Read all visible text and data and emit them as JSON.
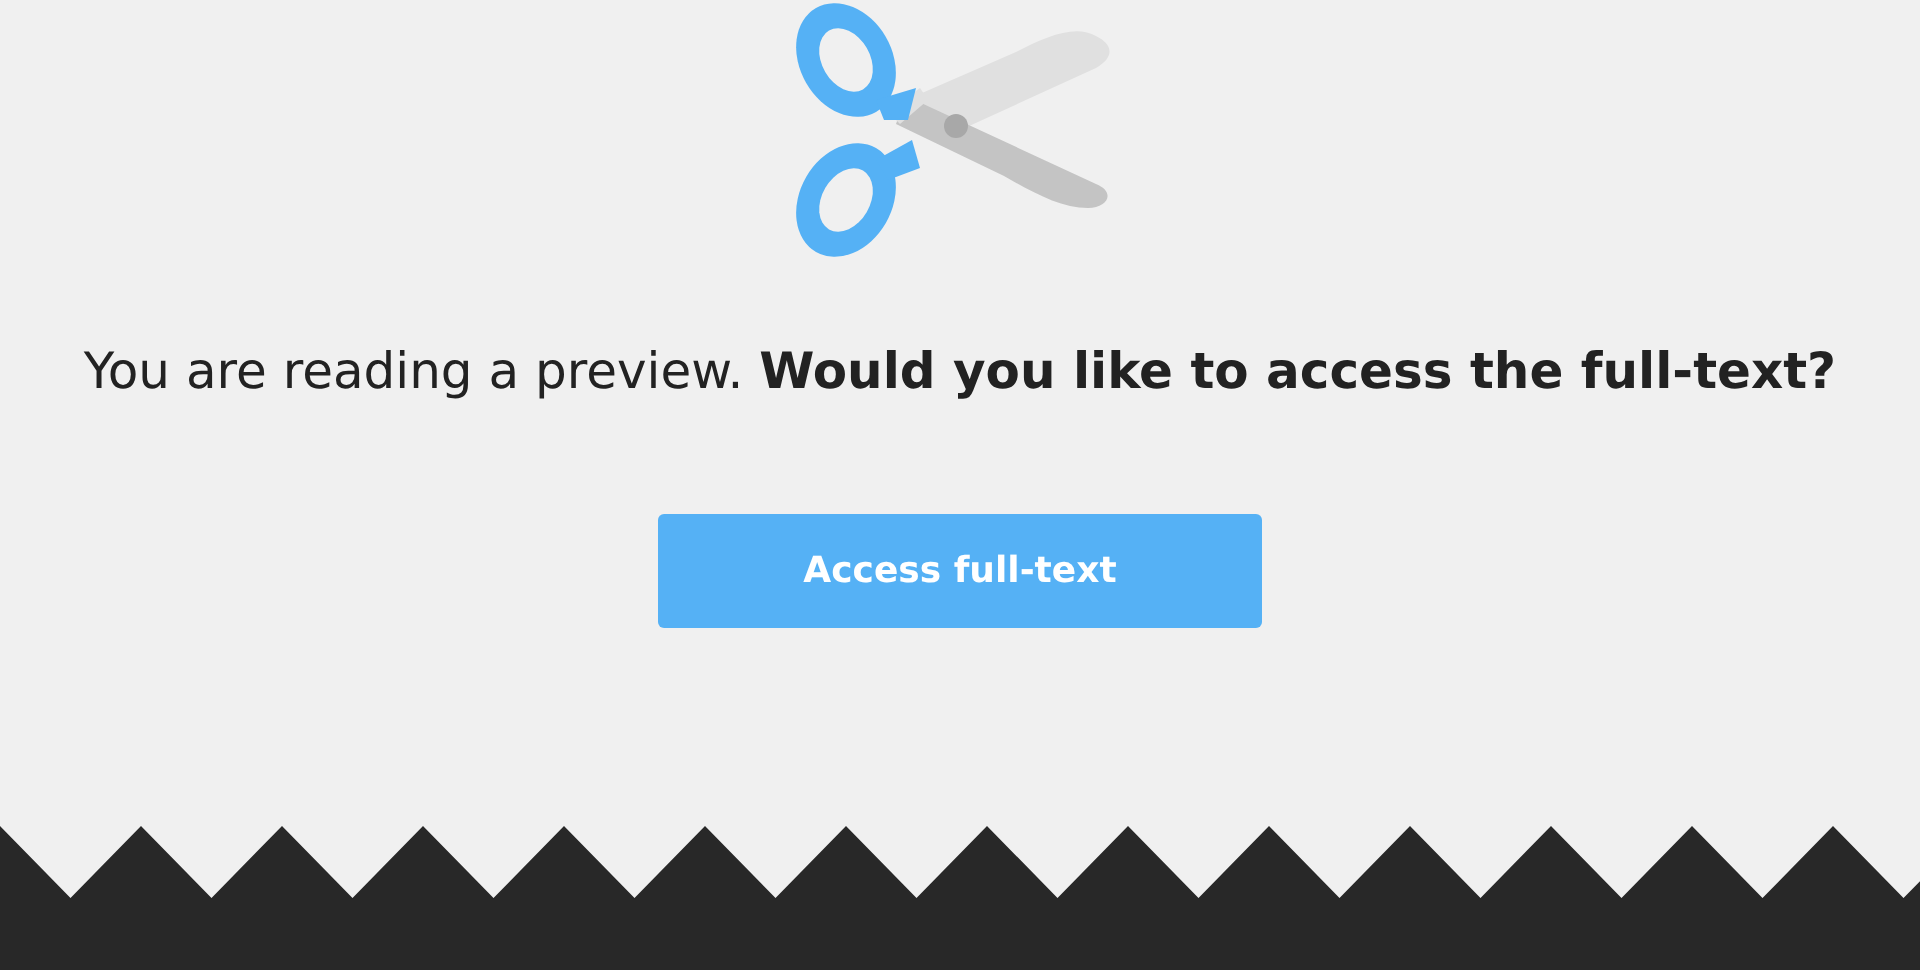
{
  "message": "You are reading a preview. **Would you like to access the full-text?**",
  "button": {
    "label": "Access full-text"
  }
}
